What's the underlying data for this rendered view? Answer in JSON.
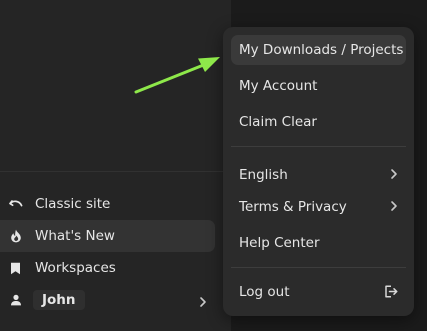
{
  "sidebar": {
    "items": [
      {
        "label": "Classic site",
        "icon": "undo-icon"
      },
      {
        "label": "What's New",
        "icon": "flame-icon"
      },
      {
        "label": "Workspaces",
        "icon": "bookmark-icon"
      }
    ],
    "user": {
      "name": "John",
      "icon": "user-icon"
    }
  },
  "menu": {
    "items": [
      {
        "label": "My Downloads / Projects"
      },
      {
        "label": "My Account"
      },
      {
        "label": "Claim Clear"
      },
      {
        "label": "English"
      },
      {
        "label": "Terms & Privacy"
      },
      {
        "label": "Help Center"
      },
      {
        "label": "Log out"
      }
    ]
  },
  "colors": {
    "arrow": "#8ee84a",
    "sidebar_bg": "#252525",
    "menu_bg": "#2b2b2b",
    "highlight": "#3a3a3a"
  }
}
